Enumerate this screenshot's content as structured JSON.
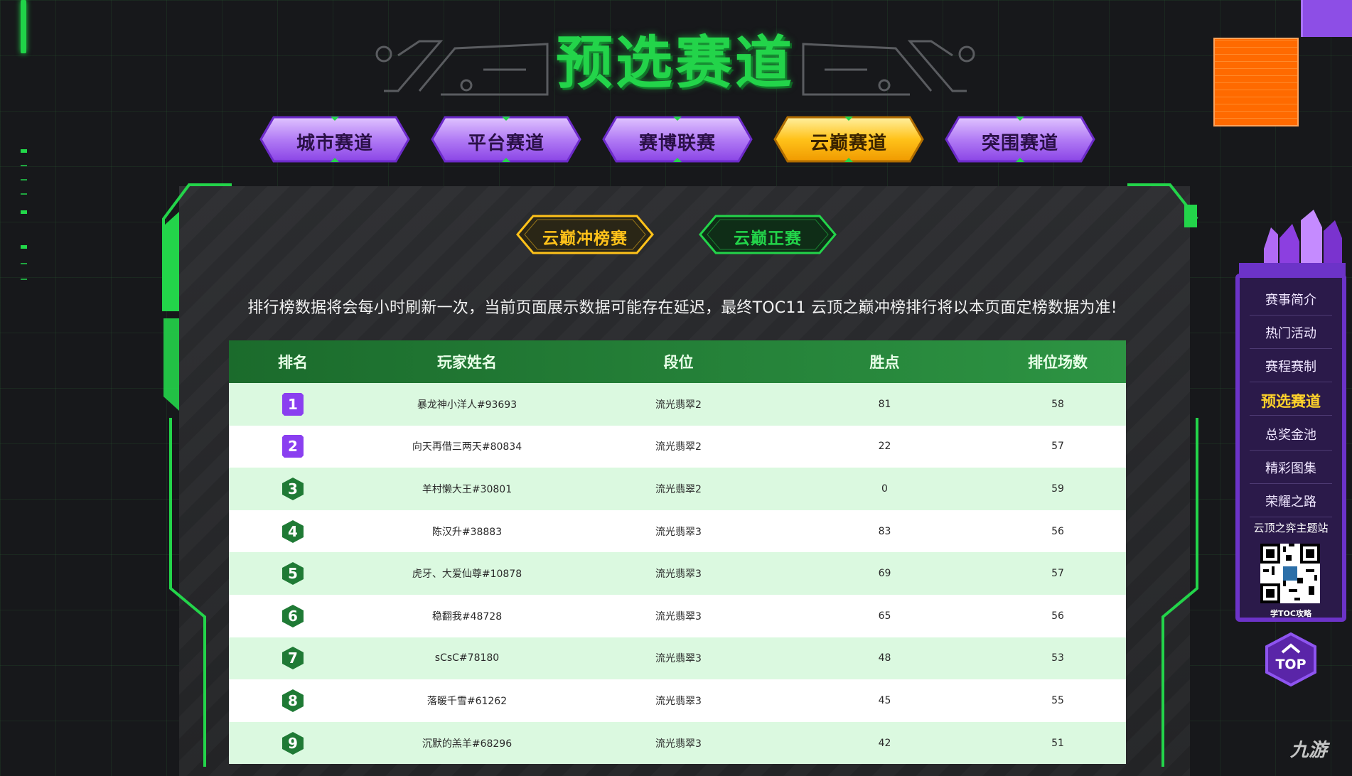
{
  "page": {
    "title": "预选赛道",
    "notice": "排行榜数据将会每小时刷新一次，当前页面展示数据可能存在延迟，最终TOC11 云顶之巅冲榜排行将以本页面定榜数据为准!"
  },
  "tabs": [
    {
      "label": "城市赛道",
      "active": false
    },
    {
      "label": "平台赛道",
      "active": false
    },
    {
      "label": "赛博联赛",
      "active": false
    },
    {
      "label": "云巅赛道",
      "active": true
    },
    {
      "label": "突围赛道",
      "active": false
    }
  ],
  "subtabs": [
    {
      "label": "云巅冲榜赛",
      "active": true
    },
    {
      "label": "云巅正赛",
      "active": false
    }
  ],
  "table": {
    "headers": [
      "排名",
      "玩家姓名",
      "段位",
      "胜点",
      "排位场数"
    ],
    "rows": [
      {
        "rank": "1",
        "name": "暴龙神小洋人#93693",
        "tier": "流光翡翠2",
        "points": "81",
        "games": "58"
      },
      {
        "rank": "2",
        "name": "向天再借三两天#80834",
        "tier": "流光翡翠2",
        "points": "22",
        "games": "57"
      },
      {
        "rank": "3",
        "name": "羊村懒大王#30801",
        "tier": "流光翡翠2",
        "points": "0",
        "games": "59"
      },
      {
        "rank": "4",
        "name": "陈汉升#38883",
        "tier": "流光翡翠3",
        "points": "83",
        "games": "56"
      },
      {
        "rank": "5",
        "name": "虎牙、大爱仙尊#10878",
        "tier": "流光翡翠3",
        "points": "69",
        "games": "57"
      },
      {
        "rank": "6",
        "name": "稳翻我#48728",
        "tier": "流光翡翠3",
        "points": "65",
        "games": "56"
      },
      {
        "rank": "7",
        "name": "sCsC#78180",
        "tier": "流光翡翠3",
        "points": "48",
        "games": "53"
      },
      {
        "rank": "8",
        "name": "落暖千雪#61262",
        "tier": "流光翡翠3",
        "points": "45",
        "games": "55"
      },
      {
        "rank": "9",
        "name": "沉默的羔羊#68296",
        "tier": "流光翡翠3",
        "points": "42",
        "games": "51"
      }
    ]
  },
  "sidebar": {
    "items": [
      {
        "label": "赛事简介",
        "active": false
      },
      {
        "label": "热门活动",
        "active": false
      },
      {
        "label": "赛程赛制",
        "active": false
      },
      {
        "label": "预选赛道",
        "active": true
      },
      {
        "label": "总奖金池",
        "active": false
      },
      {
        "label": "精彩图集",
        "active": false
      },
      {
        "label": "荣耀之路",
        "active": false
      }
    ],
    "qr_title": "云顶之弈主题站",
    "qr_caption": "学TOC攻略",
    "top_label": "TOP"
  },
  "watermark": "九游",
  "colors": {
    "accent_green": "#23d44a",
    "tab_purple": "#b27cf5",
    "tab_active_gold": "#ffc21a",
    "sidebar_purple": "#6c33c8",
    "rank_top2": "#8a3ff0",
    "rank_rest": "#1f7a35"
  }
}
